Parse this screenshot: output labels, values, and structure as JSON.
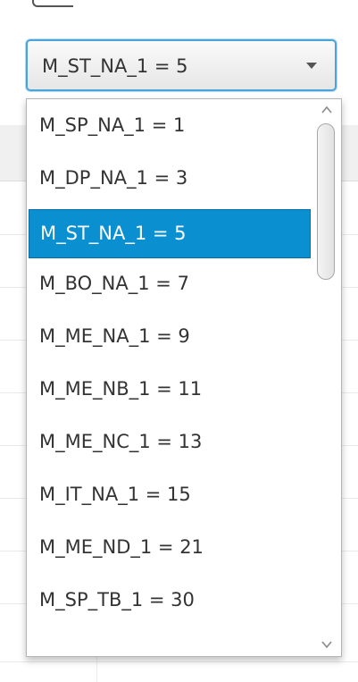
{
  "combo": {
    "selected_value": "M_ST_NA_1 = 5"
  },
  "list": {
    "items": [
      {
        "label": "M_SP_NA_1 = 1"
      },
      {
        "label": "M_DP_NA_1 = 3"
      },
      {
        "label": "M_ST_NA_1 = 5"
      },
      {
        "label": "M_BO_NA_1 = 7"
      },
      {
        "label": "M_ME_NA_1 = 9"
      },
      {
        "label": "M_ME_NB_1 = 11"
      },
      {
        "label": "M_ME_NC_1 = 13"
      },
      {
        "label": "M_IT_NA_1 = 15"
      },
      {
        "label": "M_ME_ND_1 = 21"
      },
      {
        "label": "M_SP_TB_1 = 30"
      }
    ],
    "selected_index": 2
  },
  "colors": {
    "accent": "#0a8fd0",
    "focus_border": "#4aa3d9"
  },
  "icons": {
    "combo_arrow": "chevron-down-icon",
    "scroll_up": "scroll-up-arrow-icon",
    "scroll_down": "scroll-down-arrow-icon"
  }
}
